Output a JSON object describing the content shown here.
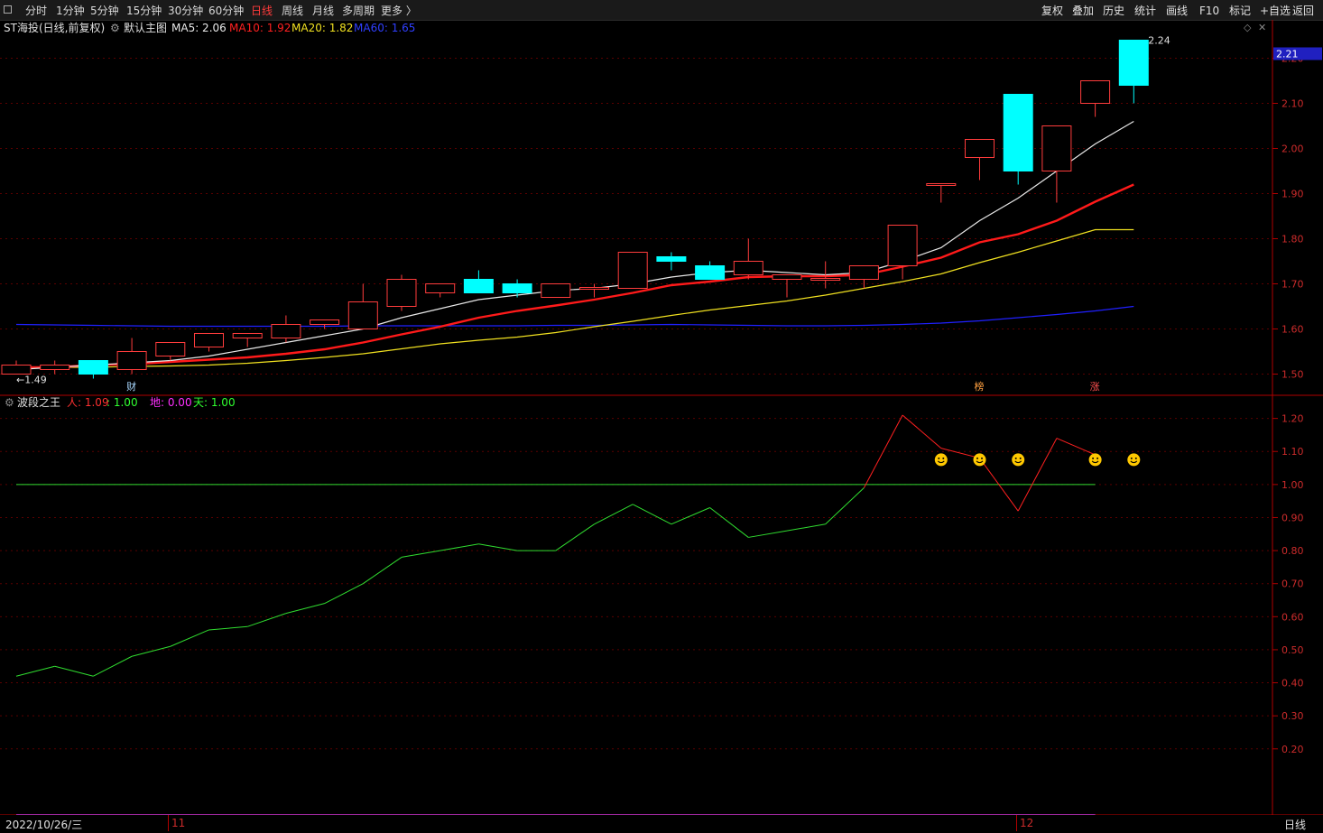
{
  "toolbar": {
    "periods": [
      "分时",
      "1分钟",
      "5分钟",
      "15分钟",
      "30分钟",
      "60分钟",
      "日线",
      "周线",
      "月线",
      "多周期",
      "更多 〉"
    ],
    "active_period": "日线",
    "right_buttons": [
      "复权",
      "叠加",
      "历史",
      "统计",
      "画线",
      "F10",
      "标记",
      "+自选",
      "返回"
    ]
  },
  "main_panel": {
    "stock_label": "ST海投(日线,前复权)",
    "template_label": "默认主图",
    "ma_labels": [
      {
        "text": "MA5: 2.06",
        "color": "#e8e8e8"
      },
      {
        "text": "MA10: 1.92",
        "color": "#ff2020"
      },
      {
        "text": "MA20: 1.82",
        "color": "#f0e020"
      },
      {
        "text": "MA60: 1.65",
        "color": "#2f3fff"
      }
    ],
    "current_price_tag": "2.21",
    "high_annotation": "2.24",
    "low_annotation": "←1.49",
    "event_marks": [
      {
        "text": "财",
        "index": 3,
        "color": "#a8d8ff"
      },
      {
        "text": "榜",
        "index": 25,
        "color": "#ffa040"
      },
      {
        "text": "涨",
        "index": 28,
        "color": "#ff5050"
      }
    ]
  },
  "indicator_panel": {
    "name": "波段之王",
    "labels": [
      {
        "text": "人: 1.09",
        "color": "#ff3030"
      },
      {
        "text": ": 1.00",
        "color": "#30ff30"
      },
      {
        "text": "地: 0.00",
        "color": "#ff30ff"
      },
      {
        "text": "天: 1.00",
        "color": "#30ff30"
      }
    ]
  },
  "date_axis": {
    "start_date": "2022/10/26/三",
    "month_labels": [
      "11",
      "12"
    ],
    "period_label": "日线"
  },
  "colors": {
    "up": "#ff3c3c",
    "down": "#00ffff",
    "ma5": "#e8e8e8",
    "ma10": "#ff1a1a",
    "ma20": "#f0e020",
    "ma60": "#2020ff",
    "indicator_green": "#30dd30",
    "indicator_red": "#ff2020",
    "axis": "#b00000",
    "smiley": "#ffc800"
  },
  "chart_data": [
    {
      "type": "candlestick",
      "title": "ST海投(日线,前复权)",
      "y_ticks": [
        1.5,
        1.6,
        1.7,
        1.8,
        1.9,
        2.0,
        2.1,
        2.2
      ],
      "ylim": [
        1.455,
        2.285
      ],
      "candles": [
        {
          "o": 1.5,
          "h": 1.53,
          "l": 1.5,
          "c": 1.52
        },
        {
          "o": 1.51,
          "h": 1.53,
          "l": 1.5,
          "c": 1.52
        },
        {
          "o": 1.53,
          "h": 1.53,
          "l": 1.49,
          "c": 1.5
        },
        {
          "o": 1.51,
          "h": 1.58,
          "l": 1.5,
          "c": 1.55
        },
        {
          "o": 1.54,
          "h": 1.57,
          "l": 1.53,
          "c": 1.57
        },
        {
          "o": 1.56,
          "h": 1.59,
          "l": 1.55,
          "c": 1.59
        },
        {
          "o": 1.58,
          "h": 1.59,
          "l": 1.56,
          "c": 1.59
        },
        {
          "o": 1.58,
          "h": 1.63,
          "l": 1.57,
          "c": 1.61
        },
        {
          "o": 1.61,
          "h": 1.62,
          "l": 1.6,
          "c": 1.62
        },
        {
          "o": 1.6,
          "h": 1.7,
          "l": 1.6,
          "c": 1.66
        },
        {
          "o": 1.65,
          "h": 1.72,
          "l": 1.64,
          "c": 1.71
        },
        {
          "o": 1.68,
          "h": 1.7,
          "l": 1.67,
          "c": 1.7
        },
        {
          "o": 1.71,
          "h": 1.73,
          "l": 1.68,
          "c": 1.68
        },
        {
          "o": 1.7,
          "h": 1.71,
          "l": 1.67,
          "c": 1.68
        },
        {
          "o": 1.67,
          "h": 1.7,
          "l": 1.67,
          "c": 1.7
        },
        {
          "o": 1.69,
          "h": 1.7,
          "l": 1.67,
          "c": 1.69
        },
        {
          "o": 1.69,
          "h": 1.77,
          "l": 1.69,
          "c": 1.77
        },
        {
          "o": 1.76,
          "h": 1.77,
          "l": 1.73,
          "c": 1.75
        },
        {
          "o": 1.74,
          "h": 1.75,
          "l": 1.71,
          "c": 1.71
        },
        {
          "o": 1.72,
          "h": 1.8,
          "l": 1.71,
          "c": 1.75
        },
        {
          "o": 1.71,
          "h": 1.72,
          "l": 1.67,
          "c": 1.72
        },
        {
          "o": 1.71,
          "h": 1.75,
          "l": 1.69,
          "c": 1.71
        },
        {
          "o": 1.71,
          "h": 1.74,
          "l": 1.69,
          "c": 1.74
        },
        {
          "o": 1.74,
          "h": 1.83,
          "l": 1.71,
          "c": 1.83
        },
        {
          "o": 1.92,
          "h": 1.92,
          "l": 1.88,
          "c": 1.92
        },
        {
          "o": 1.98,
          "h": 2.02,
          "l": 1.93,
          "c": 2.02
        },
        {
          "o": 2.12,
          "h": 2.12,
          "l": 1.92,
          "c": 1.95
        },
        {
          "o": 1.95,
          "h": 2.05,
          "l": 1.88,
          "c": 2.05
        },
        {
          "o": 2.1,
          "h": 2.15,
          "l": 2.07,
          "c": 2.15
        },
        {
          "o": 2.24,
          "h": 2.24,
          "l": 2.1,
          "c": 2.14
        }
      ],
      "ma5": [
        1.51,
        1.515,
        1.52,
        1.525,
        1.53,
        1.54,
        1.555,
        1.57,
        1.585,
        1.6,
        1.625,
        1.645,
        1.665,
        1.675,
        1.685,
        1.69,
        1.7,
        1.715,
        1.725,
        1.73,
        1.725,
        1.72,
        1.725,
        1.75,
        1.78,
        1.84,
        1.89,
        1.95,
        2.01,
        2.06
      ],
      "ma10": [
        1.515,
        1.515,
        1.52,
        1.522,
        1.527,
        1.532,
        1.537,
        1.545,
        1.555,
        1.57,
        1.588,
        1.605,
        1.625,
        1.64,
        1.652,
        1.665,
        1.68,
        1.697,
        1.705,
        1.715,
        1.717,
        1.717,
        1.72,
        1.738,
        1.758,
        1.792,
        1.81,
        1.84,
        1.882,
        1.92
      ],
      "ma20": [
        1.515,
        1.515,
        1.515,
        1.517,
        1.518,
        1.52,
        1.524,
        1.53,
        1.537,
        1.545,
        1.556,
        1.567,
        1.575,
        1.582,
        1.592,
        1.605,
        1.617,
        1.63,
        1.642,
        1.652,
        1.662,
        1.675,
        1.69,
        1.705,
        1.722,
        1.747,
        1.77,
        1.795,
        1.82,
        1.82
      ],
      "ma60": [
        1.61,
        1.609,
        1.608,
        1.607,
        1.606,
        1.606,
        1.606,
        1.606,
        1.606,
        1.607,
        1.607,
        1.607,
        1.607,
        1.607,
        1.608,
        1.608,
        1.609,
        1.61,
        1.609,
        1.608,
        1.607,
        1.607,
        1.608,
        1.61,
        1.613,
        1.618,
        1.625,
        1.632,
        1.64,
        1.65
      ]
    },
    {
      "type": "line",
      "title": "波段之王",
      "y_ticks": [
        0.2,
        0.3,
        0.4,
        0.5,
        0.6,
        0.7,
        0.8,
        0.9,
        1.0,
        1.1,
        1.2
      ],
      "ylim": [
        0.0,
        1.27
      ],
      "series": [
        {
          "name": "人",
          "values": [
            0.42,
            0.45,
            0.42,
            0.48,
            0.51,
            0.56,
            0.57,
            0.61,
            0.64,
            0.7,
            0.78,
            0.8,
            0.82,
            0.8,
            0.8,
            0.88,
            0.94,
            0.88,
            0.93,
            0.84,
            0.86,
            0.88,
            0.99,
            1.21,
            1.11,
            1.08,
            0.92,
            1.14,
            1.09
          ]
        },
        {
          "name": "天",
          "values": [
            1.0,
            1.0,
            1.0,
            1.0,
            1.0,
            1.0,
            1.0,
            1.0,
            1.0,
            1.0,
            1.0,
            1.0,
            1.0,
            1.0,
            1.0,
            1.0,
            1.0,
            1.0,
            1.0,
            1.0,
            1.0,
            1.0,
            1.0,
            1.0,
            1.0,
            1.0,
            1.0,
            1.0,
            1.0
          ]
        },
        {
          "name": "地",
          "values": [
            0.0,
            0.0,
            0.0,
            0.0,
            0.0,
            0.0,
            0.0,
            0.0,
            0.0,
            0.0,
            0.0,
            0.0,
            0.0,
            0.0,
            0.0,
            0.0,
            0.0,
            0.0,
            0.0,
            0.0,
            0.0,
            0.0,
            0.0,
            0.0,
            0.0,
            0.0,
            0.0,
            0.0,
            0.0
          ]
        }
      ],
      "smiley_indices": [
        24,
        25,
        26,
        28,
        29
      ]
    }
  ]
}
